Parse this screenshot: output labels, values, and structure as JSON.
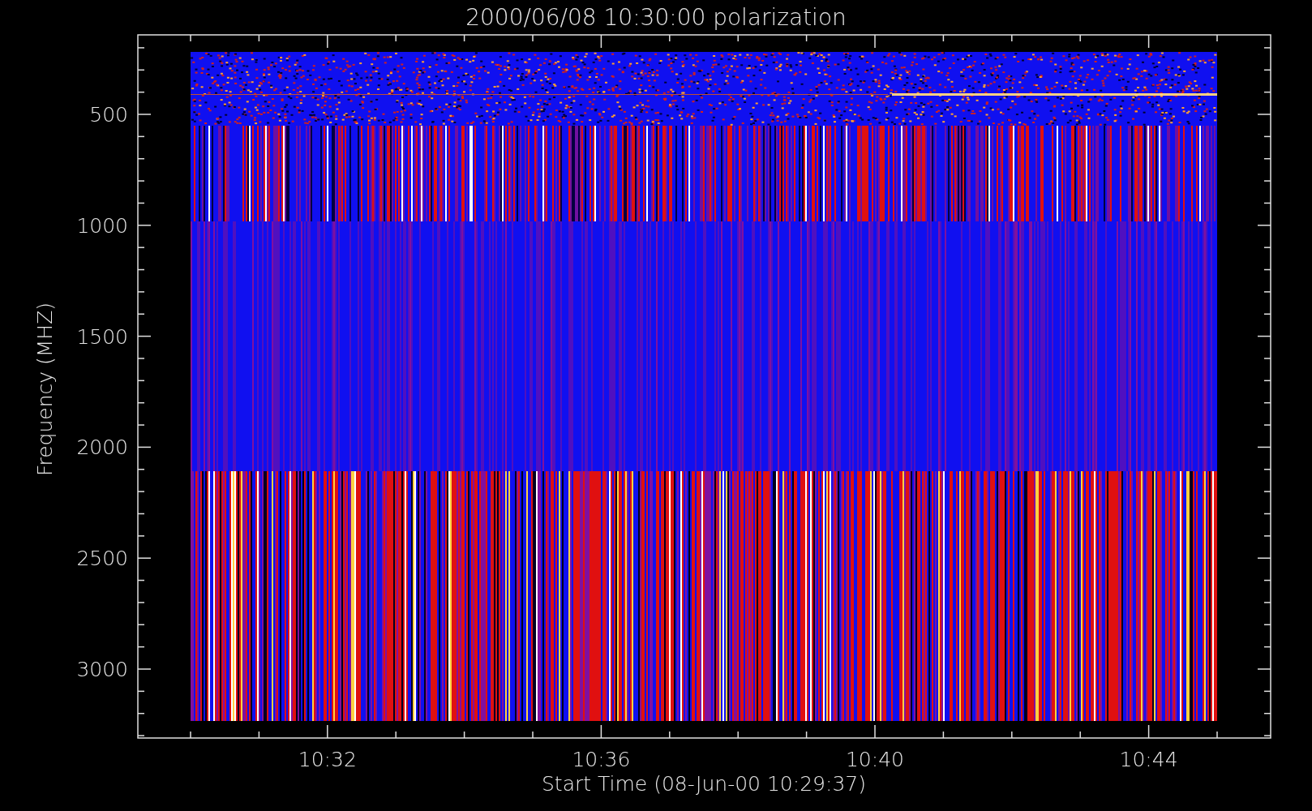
{
  "plot": {
    "title": "2000/06/08 10:30:00 polarization",
    "xlabel": "Start Time (08-Jun-00 10:29:37)",
    "ylabel": "Frequency (MHZ)",
    "xticks": [
      "10:32",
      "10:36",
      "10:40",
      "10:44"
    ],
    "yticks": [
      "500",
      "1000",
      "1500",
      "2000",
      "2500",
      "3000"
    ]
  }
}
